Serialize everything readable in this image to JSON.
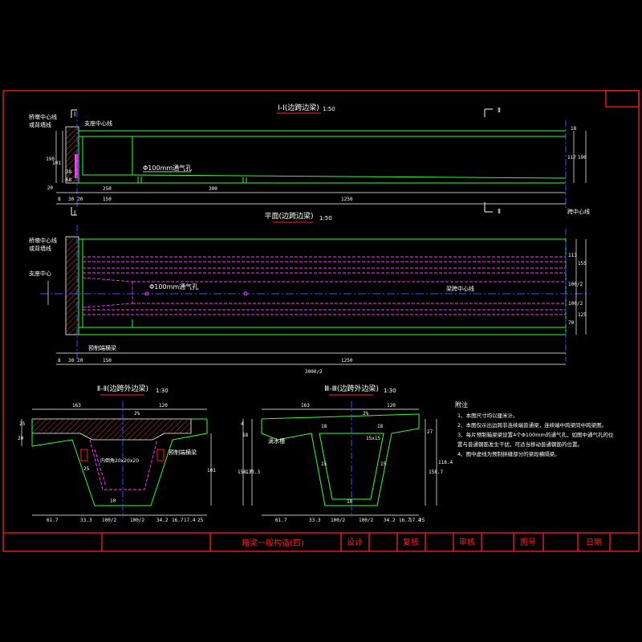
{
  "colors": {
    "frame": "#ff2020",
    "outline": "#33ff33",
    "dim": "#ffffff",
    "center": "#3355ff",
    "hidden": "#ff33ff",
    "text_yellow": "#ffff00",
    "text_white": "#ffffff",
    "title_red": "#ff2020"
  },
  "views": {
    "section_11": {
      "title": "Ⅰ-Ⅰ(边跨边梁)",
      "scale": "1:50",
      "cut_mark": "Ⅱ"
    },
    "plan": {
      "title": "平面(边跨边梁)",
      "scale": "1:50"
    },
    "section_2": {
      "title": "Ⅱ-Ⅱ(边跨外边梁)",
      "scale": "1:30"
    },
    "section_3": {
      "title": "Ⅲ-Ⅲ(边跨外边梁)",
      "scale": "1:30"
    }
  },
  "labels": {
    "pier_center": "桥墩中心线",
    "bearing_center_line": "支座中心线",
    "abutment_edge": "或背墙线",
    "bearing_center": "支座中心",
    "vent_hole": "Φ100mm通气孔",
    "beam_center": "梁跨中心线",
    "span_center": "跨中心线",
    "precast_end": "预制端横梁",
    "drip": "滴水槽",
    "inner_dims": "内倒角20x20x20",
    "end_diaphragm": "预制端横梁"
  },
  "dims_elev": {
    "left": [
      "14",
      "190",
      "101",
      "38",
      "68",
      "20"
    ],
    "bottom": [
      "8",
      "30",
      "20",
      "250",
      "150",
      "300",
      "1250"
    ],
    "right": [
      "18",
      "117",
      "190"
    ]
  },
  "dims_plan": {
    "right": [
      "18",
      "113",
      "100/2",
      "50/2",
      "100/2",
      "70",
      "125",
      "155",
      "110"
    ],
    "bottom": [
      "8",
      "30",
      "20",
      "150",
      "1250"
    ],
    "overall": "3000/2"
  },
  "dims_sec2": {
    "top": [
      "163",
      "120",
      "2%"
    ],
    "left": [
      "20",
      "25"
    ],
    "right": [
      "101",
      "18"
    ],
    "bottom": [
      "61.7",
      "33.3",
      "100/2",
      "100/2",
      "34.2",
      "16.7",
      "17.4",
      "25"
    ],
    "inner": [
      "25",
      "18",
      "10"
    ]
  },
  "dims_sec3": {
    "top": [
      "163",
      "120",
      "2%"
    ],
    "left": [
      "4",
      "18",
      "133.3",
      "158.7"
    ],
    "right": [
      "27",
      "118.4",
      "158.7"
    ],
    "bottom": [
      "61.7",
      "33.3",
      "100/2",
      "100/2",
      "34.2",
      "16.7",
      "17.4",
      "25"
    ],
    "inner": [
      "18",
      "18",
      "15",
      "15",
      "18",
      "15x15"
    ]
  },
  "notes": {
    "title": "附注",
    "items": [
      "1、本图尺寸均以厘米计。",
      "2、本图仅示出边跨非连续端普通梁，连续端中跨梁同中跨梁图。",
      "3、每片预制箱梁梁设置4个Φ100mm的通气孔，如图中通气孔的位置与普通钢筋发生干扰，可适当移动普通钢筋的位置。",
      "4、图中虚线为预制拼缝部分的梁段横隔梁。"
    ]
  },
  "title_block": {
    "drawing_title": "箱梁一般构造(四)",
    "design": "设计",
    "review": "复核",
    "audit": "审核",
    "drawing_no": "图号",
    "date": "日期"
  }
}
